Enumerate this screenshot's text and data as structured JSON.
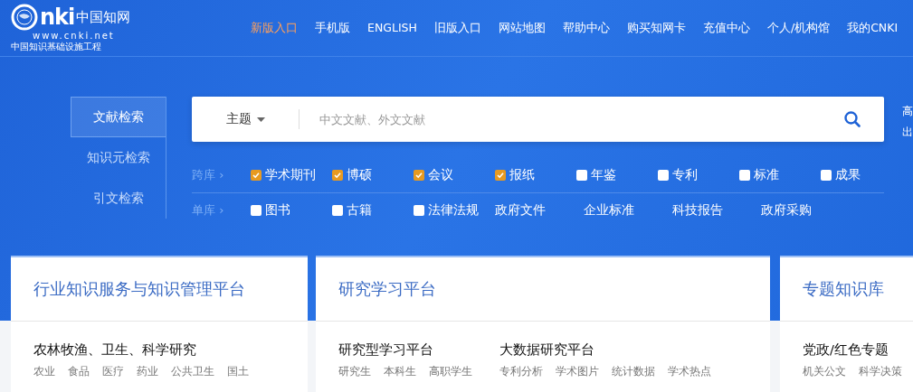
{
  "logo": {
    "mark": "nki",
    "name": "中国知网",
    "url": "www.cnki.net",
    "tagline": "中国知识基础设施工程"
  },
  "nav": [
    {
      "label": "新版入口",
      "highlighted": true
    },
    {
      "label": "手机版",
      "highlighted": false
    },
    {
      "label": "ENGLISH",
      "highlighted": false
    },
    {
      "label": "旧版入口",
      "highlighted": false
    },
    {
      "label": "网站地图",
      "highlighted": false
    },
    {
      "label": "帮助中心",
      "highlighted": false
    },
    {
      "label": "购买知网卡",
      "highlighted": false
    },
    {
      "label": "充值中心",
      "highlighted": false
    },
    {
      "label": "个人/机构馆",
      "highlighted": false
    },
    {
      "label": "我的CNKI",
      "highlighted": false
    }
  ],
  "search_tabs": [
    {
      "label": "文献检索",
      "selected": true
    },
    {
      "label": "知识元检索",
      "selected": false
    },
    {
      "label": "引文检索",
      "selected": false
    }
  ],
  "search": {
    "field": "主题",
    "placeholder": "中文文献、外文文献"
  },
  "side_links": [
    "高",
    "出"
  ],
  "database_rows": [
    {
      "label": "跨库 ›",
      "items": [
        {
          "kind": "checkbox",
          "label": "学术期刊",
          "checked": true
        },
        {
          "kind": "checkbox",
          "label": "博硕",
          "checked": true
        },
        {
          "kind": "checkbox",
          "label": "会议",
          "checked": true
        },
        {
          "kind": "checkbox",
          "label": "报纸",
          "checked": true
        },
        {
          "kind": "checkbox",
          "label": "年鉴",
          "checked": false
        },
        {
          "kind": "checkbox",
          "label": "专利",
          "checked": false
        },
        {
          "kind": "checkbox",
          "label": "标准",
          "checked": false
        },
        {
          "kind": "checkbox",
          "label": "成果",
          "checked": false
        }
      ]
    },
    {
      "label": "单库 ›",
      "items": [
        {
          "kind": "checkbox",
          "label": "图书",
          "checked": false
        },
        {
          "kind": "checkbox",
          "label": "古籍",
          "checked": false
        },
        {
          "kind": "checkbox",
          "label": "法律法规",
          "checked": false
        },
        {
          "kind": "link",
          "label": "政府文件"
        },
        {
          "kind": "link",
          "label": "企业标准"
        },
        {
          "kind": "link",
          "label": "科技报告"
        },
        {
          "kind": "link",
          "label": "政府采购"
        }
      ]
    }
  ],
  "cards": [
    {
      "title": "行业知识服务与知识管理平台",
      "groups": [
        {
          "title": "农林牧渔、卫生、科学研究",
          "tags": [
            "农业",
            "食品",
            "医疗",
            "药业",
            "公共卫生",
            "国土"
          ]
        }
      ]
    },
    {
      "title": "研究学习平台",
      "groups": [
        {
          "title": "研究型学习平台",
          "tags": [
            "研究生",
            "本科生",
            "高职学生"
          ]
        },
        {
          "title": "大数据研究平台",
          "tags": [
            "专利分析",
            "学术图片",
            "统计数据",
            "学术热点"
          ]
        }
      ]
    },
    {
      "title": "专题知识库",
      "groups": [
        {
          "title": "党政/红色专题",
          "tags": [
            "机关公文",
            "科学决策"
          ]
        }
      ]
    }
  ]
}
